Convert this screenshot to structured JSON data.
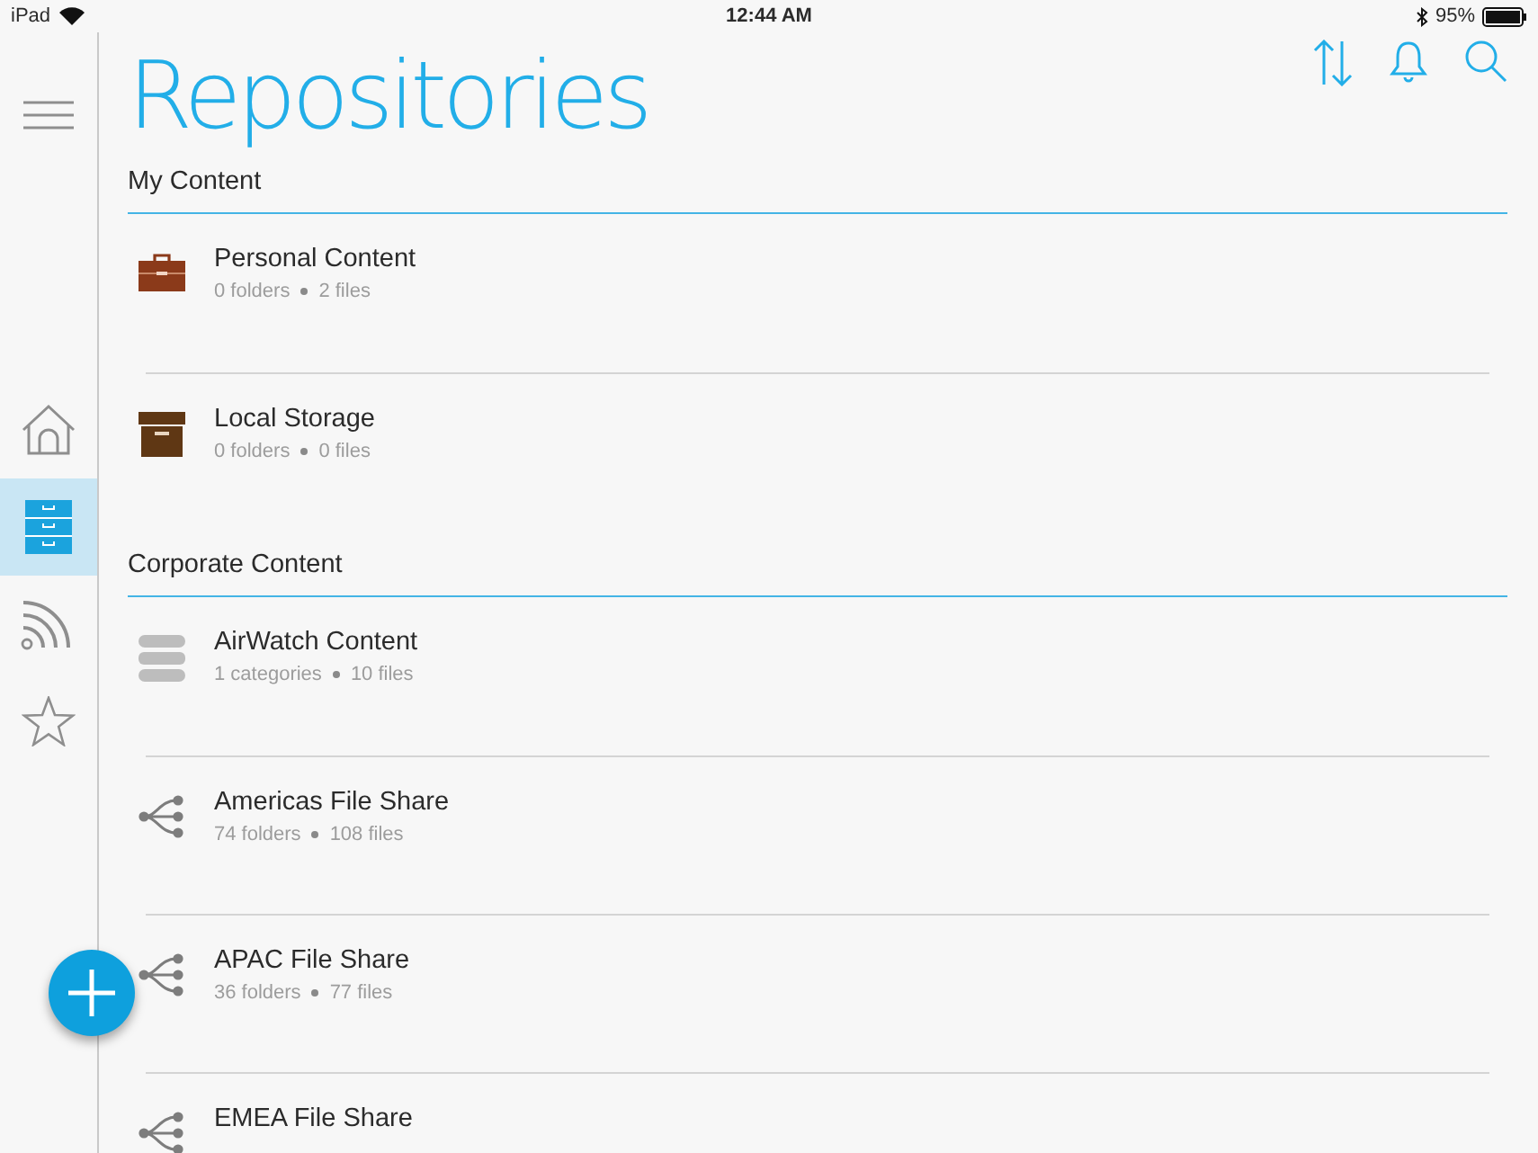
{
  "status_bar": {
    "device": "iPad",
    "time": "12:44 AM",
    "battery": "95%"
  },
  "nav": {
    "items": [
      {
        "kind": "home",
        "selected": false
      },
      {
        "kind": "repositories",
        "selected": true
      },
      {
        "kind": "feed",
        "selected": false
      },
      {
        "kind": "favorites",
        "selected": false
      }
    ]
  },
  "title": "Repositories",
  "sections": [
    {
      "title": "My Content",
      "items": [
        {
          "kind": "briefcase",
          "name": "Personal Content",
          "counts": [
            "0 folders",
            "2 files"
          ]
        },
        {
          "kind": "box",
          "name": "Local Storage",
          "counts": [
            "0 folders",
            "0 files"
          ]
        }
      ]
    },
    {
      "title": "Corporate Content",
      "items": [
        {
          "kind": "database",
          "name": "AirWatch Content",
          "counts": [
            "1 categories",
            "10 files"
          ]
        },
        {
          "kind": "share",
          "name": "Americas File Share",
          "counts": [
            "74 folders",
            "108 files"
          ]
        },
        {
          "kind": "share",
          "name": "APAC File Share",
          "counts": [
            "36 folders",
            "77 files"
          ]
        },
        {
          "kind": "share",
          "name": "EMEA File Share"
        }
      ]
    }
  ]
}
